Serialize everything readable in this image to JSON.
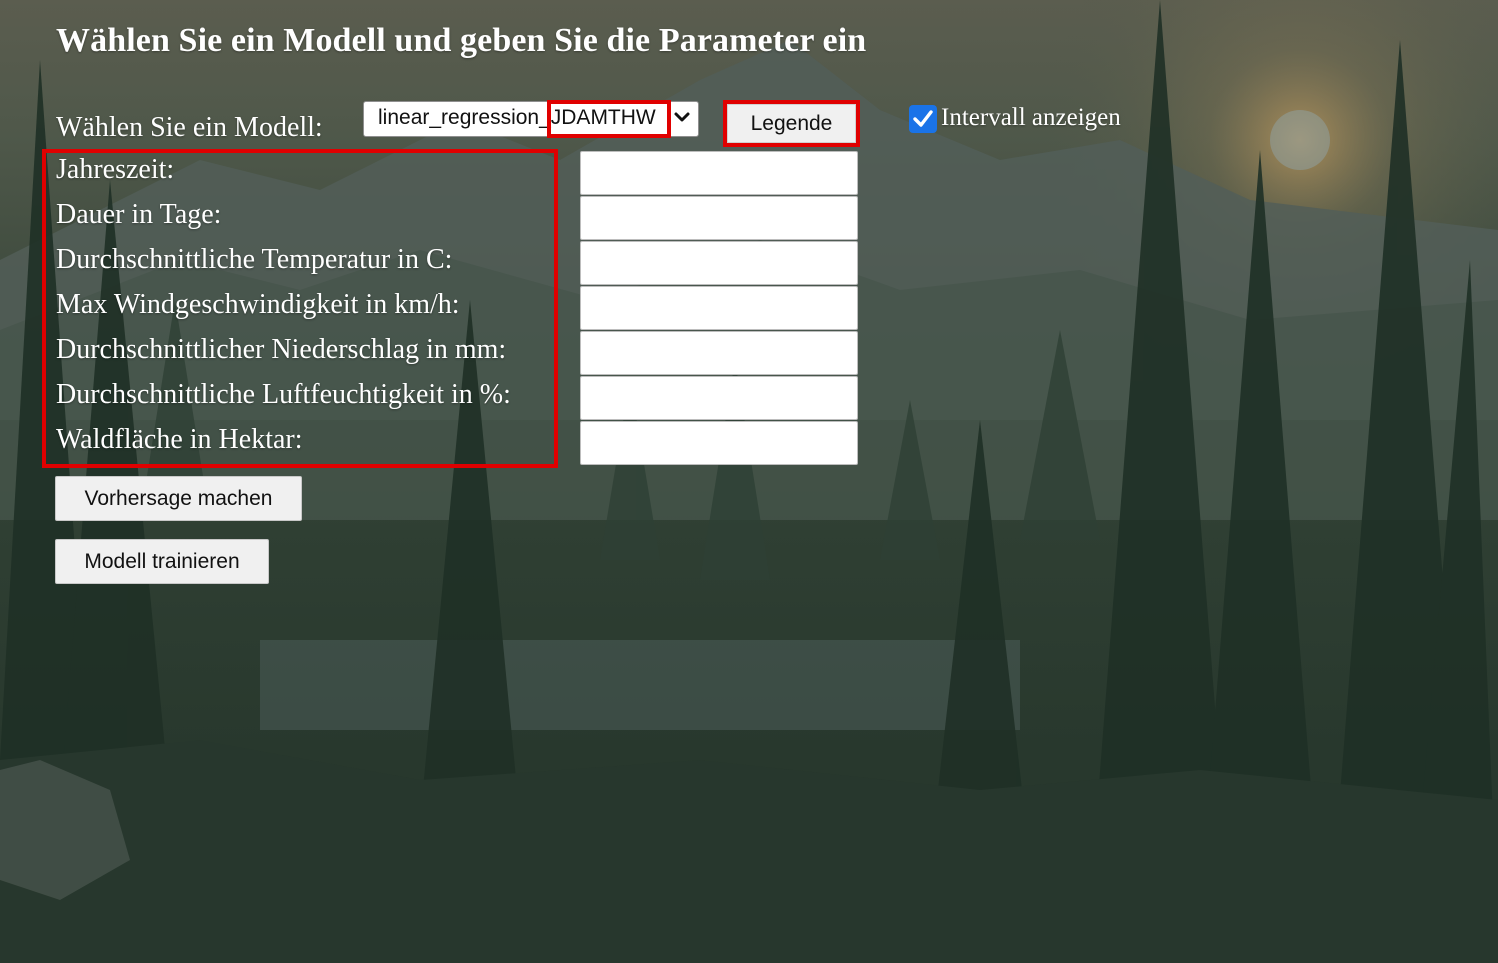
{
  "header": {
    "title": "Wählen Sie ein Modell und geben Sie die Parameter ein"
  },
  "model_select": {
    "label": "Wählen Sie ein Modell:",
    "selected_value": "linear_regression_JDAMTHW",
    "icon": "chevron-down-icon"
  },
  "legend_button": {
    "label": "Legende"
  },
  "interval_checkbox": {
    "label": "Intervall anzeigen",
    "checked": true
  },
  "params": [
    {
      "label": "Jahreszeit:",
      "value": ""
    },
    {
      "label": "Dauer in Tage:",
      "value": ""
    },
    {
      "label": "Durchschnittliche Temperatur in C:",
      "value": ""
    },
    {
      "label": "Max Windgeschwindigkeit in km/h:",
      "value": ""
    },
    {
      "label": "Durchschnittlicher Niederschlag in mm:",
      "value": ""
    },
    {
      "label": "Durchschnittliche Luftfeuchtigkeit in %:",
      "value": ""
    },
    {
      "label": "Waldfläche in Hektar:",
      "value": ""
    }
  ],
  "actions": {
    "predict_label": "Vorhersage machen",
    "train_label": "Modell trainieren"
  },
  "colors": {
    "highlight": "#e00000",
    "checkbox": "#1a73e8",
    "text": "#ffffff",
    "button_bg": "#f0f0f0"
  }
}
